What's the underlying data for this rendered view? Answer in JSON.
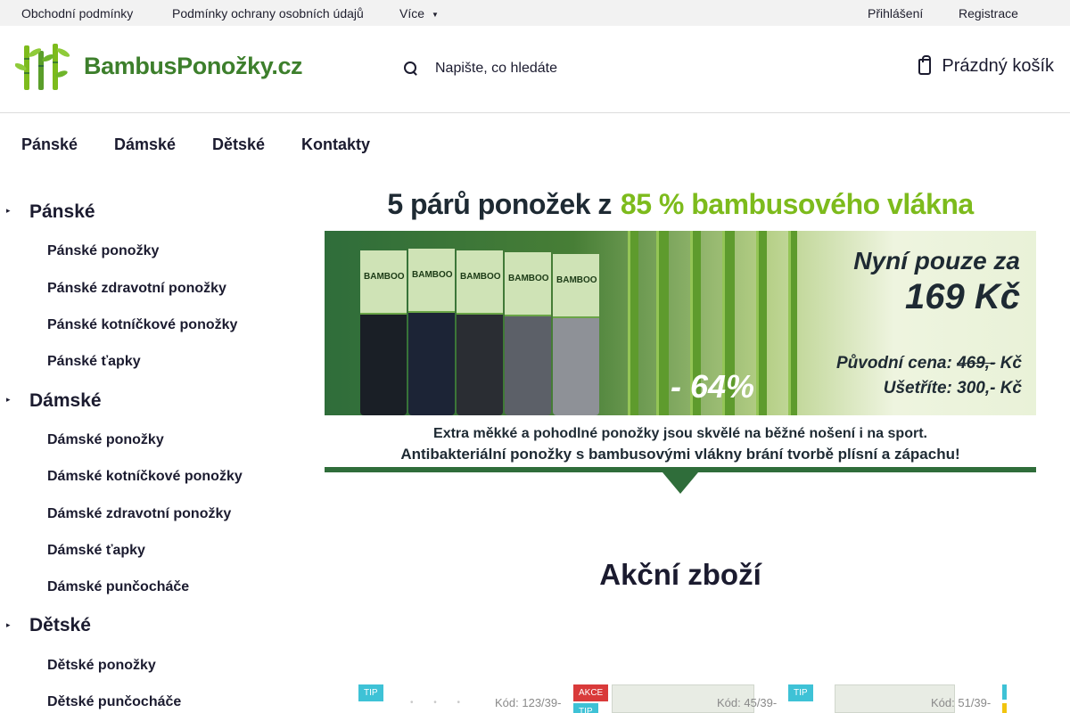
{
  "topbar": {
    "links": [
      "Obchodní podmínky",
      "Podmínky ochrany osobních údajů"
    ],
    "more_label": "Více",
    "login_label": "Přihlášení",
    "register_label": "Registrace"
  },
  "header": {
    "logo_text": "BambusPonožky.cz",
    "search_placeholder": "Napište, co hledáte",
    "cart_label": "Prázdný košík"
  },
  "nav": {
    "items": [
      "Pánské",
      "Dámské",
      "Dětské",
      "Kontakty"
    ]
  },
  "sidebar": {
    "categories": [
      {
        "name": "Pánské",
        "items": [
          "Pánské ponožky",
          "Pánské zdravotní ponožky",
          "Pánské kotníčkové ponožky",
          "Pánské ťapky"
        ]
      },
      {
        "name": "Dámské",
        "items": [
          "Dámské ponožky",
          "Dámské kotníčkové ponožky",
          "Dámské zdravotní ponožky",
          "Dámské ťapky",
          "Dámské punčocháče"
        ]
      },
      {
        "name": "Dětské",
        "items": [
          "Dětské ponožky",
          "Dětské punčocháče"
        ]
      }
    ]
  },
  "banner": {
    "headline_part1": "5 párů ponožek z",
    "headline_part2": "85 % bambusového vlákna",
    "pack_brand": "BAMBOO",
    "price_line1": "Nyní pouze za",
    "price_line2": "169 Kč",
    "discount": "- 64%",
    "original_label": "Původní cena:",
    "original_price": "469,-",
    "original_currency": "Kč",
    "save_line": "Ušetříte: 300,- Kč",
    "footer_line1": "Extra měkké a pohodlné ponožky jsou skvělé na běžné nošení i na sport.",
    "footer_line2": "Antibakteriální ponožky s bambusovými vlákny brání tvorbě plísní a zápachu!"
  },
  "products_section": {
    "title": "Akční zboží",
    "flags": {
      "tip": "TIP",
      "akce": "AKCE"
    },
    "codes": [
      "Kód: 123/39-",
      "Kód: 45/39-",
      "Kód: 51/39-"
    ]
  },
  "colors": {
    "brand_green": "#3d7f2c",
    "accent_lime": "#7dbb1c",
    "banner_dark_green": "#2f6d3a",
    "flag_tip": "#3ec2d6",
    "flag_akce": "#d93a3a",
    "text_dark": "#1b1b2f"
  },
  "icons": [
    "chevron-down-icon",
    "search-icon",
    "cart-icon",
    "expand-icon",
    "bamboo-logo-icon"
  ]
}
